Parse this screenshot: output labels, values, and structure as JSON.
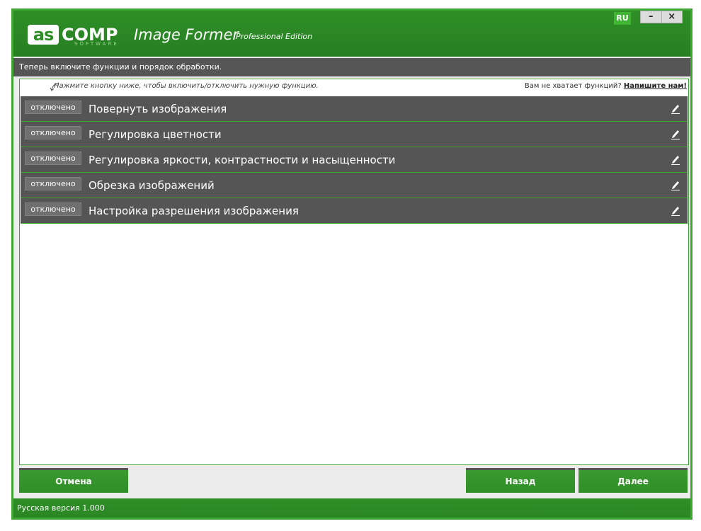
{
  "header": {
    "logo_mark": "as",
    "logo_rest": "COMP",
    "logo_software": "SOFTWARE",
    "app_title": "Image Former",
    "edition": "Professional Edition",
    "language": "RU",
    "minimize_glyph": "–",
    "close_glyph": "×"
  },
  "instruction": "Теперь включите функции и порядок обработки.",
  "hint": "Нажмите кнопку ниже, чтобы включить/отключить нужную функцию.",
  "missing": {
    "text": "Вам не хватает функций?",
    "link": "Напишите нам!"
  },
  "functions": [
    {
      "state": "отключено",
      "label": "Повернуть изображения"
    },
    {
      "state": "отключено",
      "label": "Регулировка цветности"
    },
    {
      "state": "отключено",
      "label": "Регулировка яркости, контрастности и насыщенности"
    },
    {
      "state": "отключено",
      "label": "Обрезка изображений"
    },
    {
      "state": "отключено",
      "label": "Настройка разрешения изображения"
    }
  ],
  "buttons": {
    "cancel": "Отмена",
    "back": "Назад",
    "next": "Далее"
  },
  "status": "Русская версия 1.000",
  "colors": {
    "brand_green": "#2f8f27",
    "row_gray": "#555555",
    "accent_border": "#3fa533"
  }
}
